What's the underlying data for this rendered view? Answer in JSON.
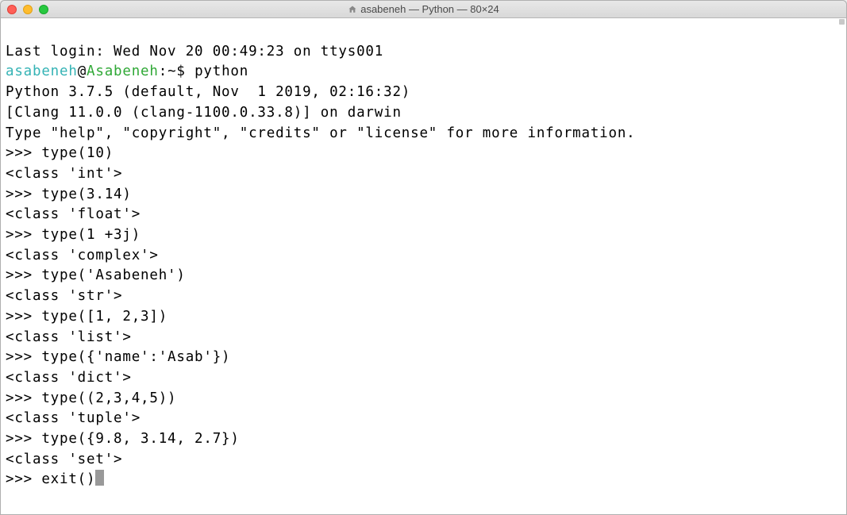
{
  "titlebar": {
    "title": "asabeneh — Python — 80×24"
  },
  "terminal": {
    "last_login": "Last login: Wed Nov 20 00:49:23 on ttys001",
    "prompt": {
      "user": "asabeneh",
      "at": "@",
      "host": "Asabeneh",
      "sep": ":",
      "path": "~",
      "dollar": "$",
      "command": "python"
    },
    "python_banner": [
      "Python 3.7.5 (default, Nov  1 2019, 02:16:32)",
      "[Clang 11.0.0 (clang-1100.0.33.8)] on darwin",
      "Type \"help\", \"copyright\", \"credits\" or \"license\" for more information."
    ],
    "repl": [
      {
        "in": ">>> type(10)",
        "out": "<class 'int'>"
      },
      {
        "in": ">>> type(3.14)",
        "out": "<class 'float'>"
      },
      {
        "in": ">>> type(1 +3j)",
        "out": "<class 'complex'>"
      },
      {
        "in": ">>> type('Asabeneh')",
        "out": "<class 'str'>"
      },
      {
        "in": ">>> type([1, 2,3])",
        "out": "<class 'list'>"
      },
      {
        "in": ">>> type({'name':'Asab'})",
        "out": "<class 'dict'>"
      },
      {
        "in": ">>> type((2,3,4,5))",
        "out": "<class 'tuple'>"
      },
      {
        "in": ">>> type({9.8, 3.14, 2.7})",
        "out": "<class 'set'>"
      }
    ],
    "final_input": ">>> exit()"
  }
}
